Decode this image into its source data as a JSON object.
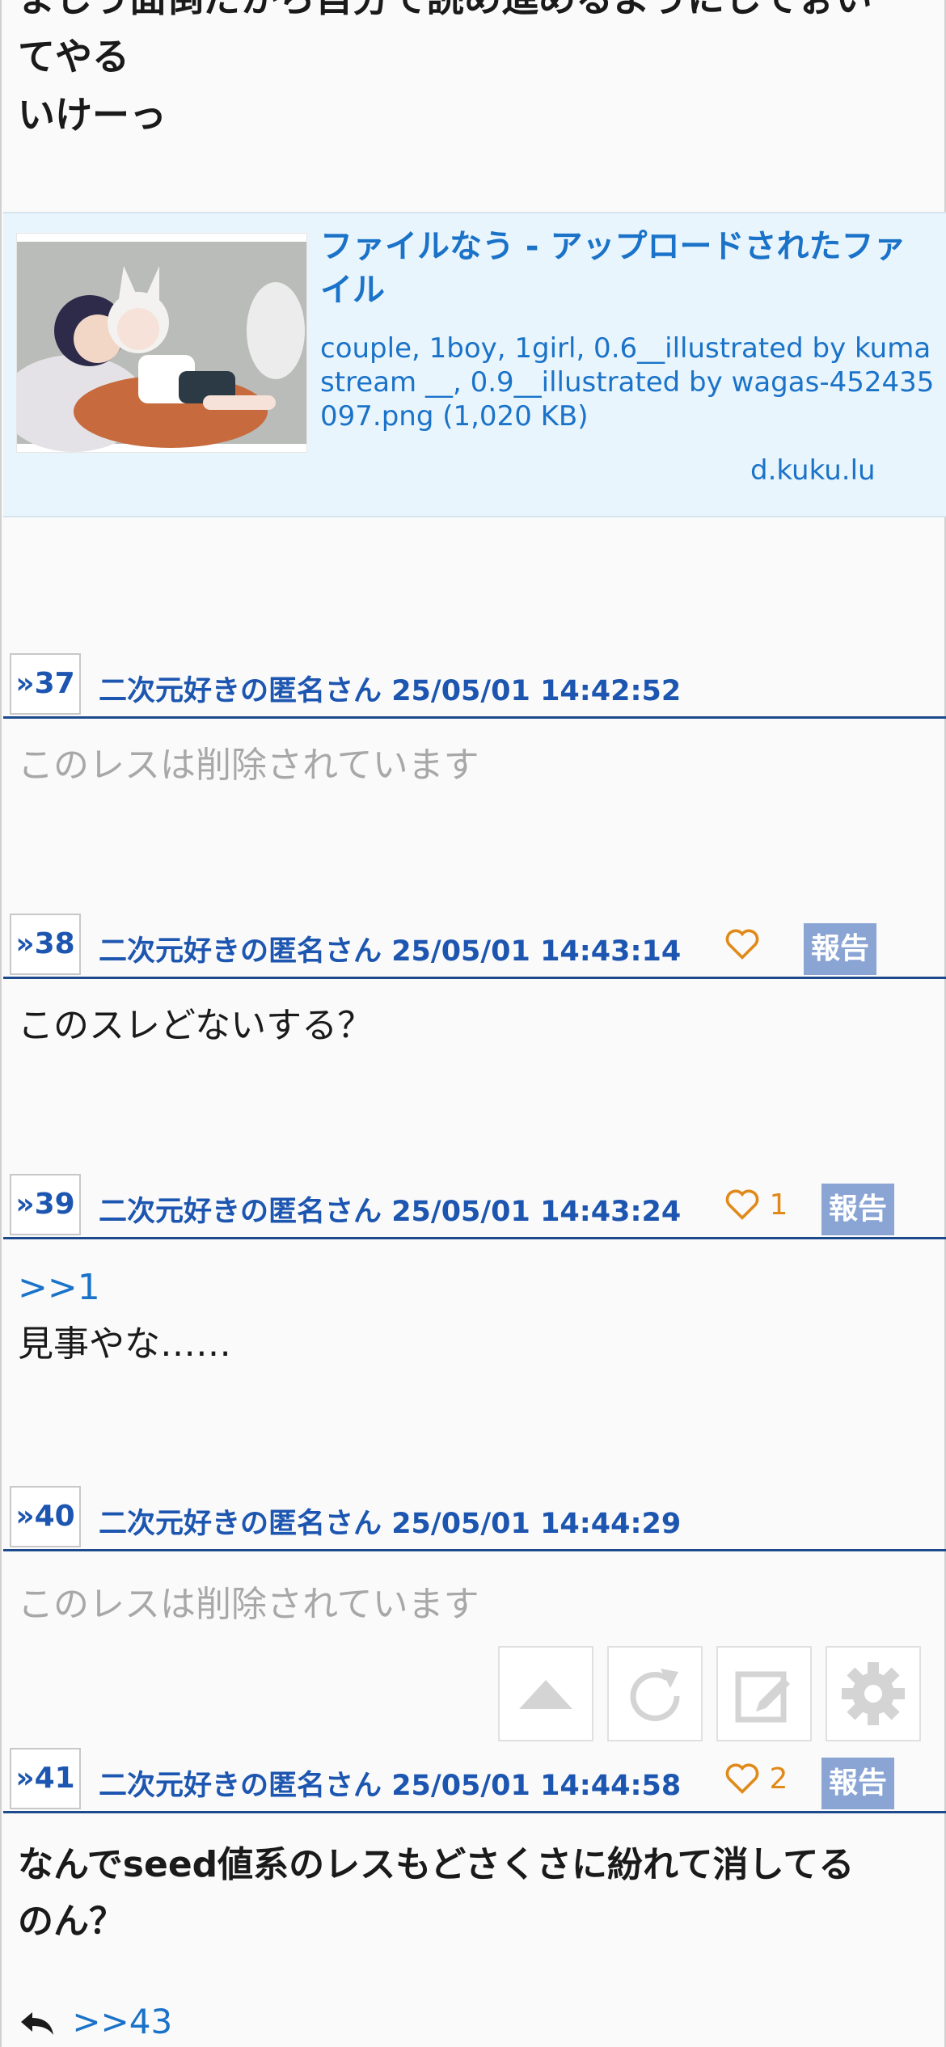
{
  "top_post": {
    "line1": "ましう面倒だから自分で読め進めるようにしてぉい",
    "line2": "てやる",
    "line3": "いけーっ"
  },
  "link_card": {
    "title": "ファイルなう - アップロードされたファイル",
    "description": "couple, 1boy, 1girl, 0.6__illustrated by kumastream __, 0.9__illustrated by wagas-452435097.png (1,020 KB)",
    "domain": "d.kuku.lu"
  },
  "posts": [
    {
      "number": "»37",
      "author": "二次元好きの匿名さん",
      "datetime": "25/05/01 14:42:52",
      "body": "このレスは削除されています"
    },
    {
      "number": "»38",
      "author": "二次元好きの匿名さん",
      "datetime": "25/05/01 14:43:14",
      "like_count": "",
      "report": "報告",
      "body": "このスレどないする？"
    },
    {
      "number": "»39",
      "author": "二次元好きの匿名さん",
      "datetime": "25/05/01 14:43:24",
      "like_count": "1",
      "report": "報告",
      "anchor": ">>1",
      "body": "見事やな……"
    },
    {
      "number": "»40",
      "author": "二次元好きの匿名さん",
      "datetime": "25/05/01 14:44:29",
      "body": "このレスは削除されています"
    },
    {
      "number": "»41",
      "author": "二次元好きの匿名さん",
      "datetime": "25/05/01 14:44:58",
      "like_count": "2",
      "report": "報告",
      "body_line1": "なんでseed値系のレスもどさくさに紛れて消してる",
      "body_line2": "のん？",
      "reply": ">>43"
    }
  ],
  "toolbar": {
    "icons": [
      "scroll-top-icon",
      "refresh-icon",
      "compose-icon",
      "settings-icon"
    ]
  },
  "colors": {
    "link": "#1a73c8",
    "header_text": "#1d56b0",
    "header_border": "#1d4a8c",
    "like": "#e08a1a",
    "report_bg": "#8aa4d4",
    "card_bg": "#e9f5fd"
  }
}
